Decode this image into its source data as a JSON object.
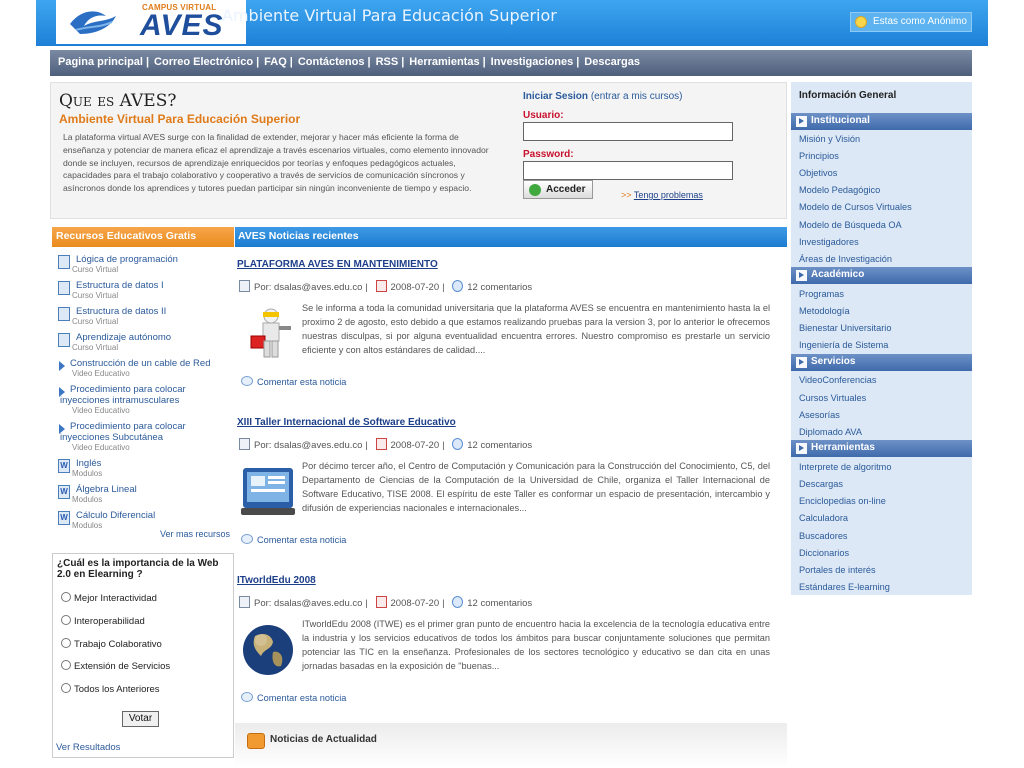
{
  "header": {
    "logo_small": "CAMPUS VIRTUAL",
    "logo_main": "AVES",
    "site_title": "Ambiente Virtual Para Educación Superior",
    "user_status": "Estas como Anónimo"
  },
  "nav": {
    "items": [
      "Pagina principal",
      "Correo Electrónico",
      "FAQ",
      "Contáctenos",
      "RSS",
      "Herramientas",
      "Investigaciones",
      "Descargas"
    ],
    "separator": "|"
  },
  "about": {
    "title": "Que es AVES?",
    "subtitle": "Ambiente Virtual Para Educación Superior",
    "text": "La plataforma virtual AVES surge con la finalidad de extender, mejorar y hacer más eficiente la forma de enseñanza y potenciar de manera eficaz el aprendizaje a través escenarios virtuales, como elemento innovador donde se incluyen, recursos de aprendizaje enriquecidos por teorías y enfoques pedagógicos actuales, capacidades para el trabajo colaborativo y cooperativo a través de servicios de comunicación síncronos y asíncronos donde los aprendices y tutores puedan participar sin ningún inconveniente de tiempo y espacio."
  },
  "login": {
    "title": "Iniciar Sesion",
    "title_note": "(entrar a mis cursos)",
    "user_label": "Usuario:",
    "user_value": "",
    "password_label": "Password:",
    "password_value": "",
    "submit": "Acceder",
    "forgot_prefix": ">>",
    "forgot": "Tengo problemas"
  },
  "resources": {
    "heading": "Recursos Educativos Gratis",
    "items": [
      {
        "title": "Lógica de programación",
        "type": "Curso Virtual",
        "icon": "document-icon"
      },
      {
        "title": "Estructura de datos I",
        "type": "Curso Virtual",
        "icon": "document-icon"
      },
      {
        "title": "Estructura de datos II",
        "type": "Curso Virtual",
        "icon": "document-icon"
      },
      {
        "title": "Aprendizaje autónomo",
        "type": "Curso Virtual",
        "icon": "document-icon"
      },
      {
        "title": "Construcción de un cable de Red",
        "type": "Video Educativo",
        "icon": "play-icon"
      },
      {
        "title": "Procedimiento para colocar inyecciones intramusculares",
        "type": "Video Educativo",
        "icon": "play-icon"
      },
      {
        "title": "Procedimiento para colocar inyecciones Subcutánea",
        "type": "Video Educativo",
        "icon": "play-icon"
      },
      {
        "title": "Inglés",
        "type": "Modulos",
        "icon": "word-doc-icon"
      },
      {
        "title": "Álgebra Lineal",
        "type": "Modulos",
        "icon": "word-doc-icon"
      },
      {
        "title": "Cálculo Diferencial",
        "type": "Modulos",
        "icon": "word-doc-icon"
      }
    ],
    "more": "Ver mas recursos"
  },
  "poll": {
    "question": "¿Cuál es la importancia de la Web 2.0 en Elearning ?",
    "options": [
      "Mejor Interactividad",
      "Interoperabilidad",
      "Trabajo Colaborativo",
      "Extensión de Servicios",
      "Todos los Anteriores"
    ],
    "vote": "Votar",
    "results": "Ver Resultados"
  },
  "news": {
    "heading": "AVES Noticias recientes",
    "items": [
      {
        "title": "PLATAFORMA AVES EN MANTENIMIENTO",
        "author": "Por: dsalas@aves.edu.co",
        "date": "2008-07-20",
        "comments": "12 comentarios",
        "text": "Se le informa a toda la comunidad universitaria que la plataforma AVES se encuentra en mantenimiento hasta la el proximo 2 de agosto, esto debido a que estamos realizando pruebas para la version 3, por lo anterior le ofrecemos nuestras disculpas, si por alguna eventualidad encuentra errores. Nuestro compromiso es prestarle un servicio eficiente y con altos estándares de calidad....",
        "comment_link": "Comentar esta noticia",
        "image": "worker-with-toolbox"
      },
      {
        "title": "XIII Taller Internacional de Software Educativo",
        "author": "Por: dsalas@aves.edu.co",
        "date": "2008-07-20",
        "comments": "12 comentarios",
        "text": "Por décimo tercer año, el Centro de Computación y Comunicación para la Construcción del Conocimiento, C5, del Departamento de Ciencias de la Computación de la Universidad de Chile, organiza el Taller Internacional de Software Educativo, TISE 2008. El espíritu de este Taller es conformar un espacio de presentación, intercambio y difusión de experiencias nacionales e internacionales...",
        "comment_link": "Comentar esta noticia",
        "image": "laptop-screen"
      },
      {
        "title": "ITworldEdu 2008",
        "author": "Por: dsalas@aves.edu.co",
        "date": "2008-07-20",
        "comments": "12 comentarios",
        "text": "ITworldEdu 2008 (ITWE) es el primer gran punto de encuentro hacia la excelencia de la tecnología educativa entre la industria y los servicios educativos de todos los ámbitos para buscar conjuntamente soluciones que permitan potenciar las TIC en la enseñanza. Profesionales de los sectores tecnológico y educativo se dan cita en unas jornadas basadas en la exposición de \"buenas...",
        "comment_link": "Comentar esta noticia",
        "image": "globe"
      }
    ],
    "current_label": "Noticias de Actualidad"
  },
  "sidebar": {
    "heading": "Información General",
    "sections": [
      {
        "title": "Institucional",
        "links": [
          "Misión y Visión",
          "Principios",
          "Objetivos",
          "Modelo Pedagógico",
          "Modelo de Cursos Virtuales",
          "Modelo de Búsqueda OA",
          "Investigadores",
          "Áreas de Investigación"
        ]
      },
      {
        "title": "Académico",
        "links": [
          "Programas",
          "Metodología",
          "Bienestar Universitario",
          "Ingeniería de Sistema"
        ]
      },
      {
        "title": "Servicios",
        "links": [
          "VideoConferencias",
          "Cursos Virtuales",
          "Asesorías",
          "Diplomado AVA"
        ]
      },
      {
        "title": "Herramientas",
        "links": [
          "Interprete de algoritmo",
          "Descargas",
          "Enciclopedias on-line",
          "Calculadora",
          "Buscadores",
          "Diccionarios",
          "Portales de interés",
          "Estándares E-learning"
        ]
      }
    ]
  },
  "colors": {
    "header_blue": "#1d80d6",
    "orange": "#e98b1d",
    "nav_gray": "#4e5f7c",
    "sidebar_bg": "#dce8f5",
    "link_blue": "#2b5a9a",
    "login_red": "#c8102e"
  }
}
